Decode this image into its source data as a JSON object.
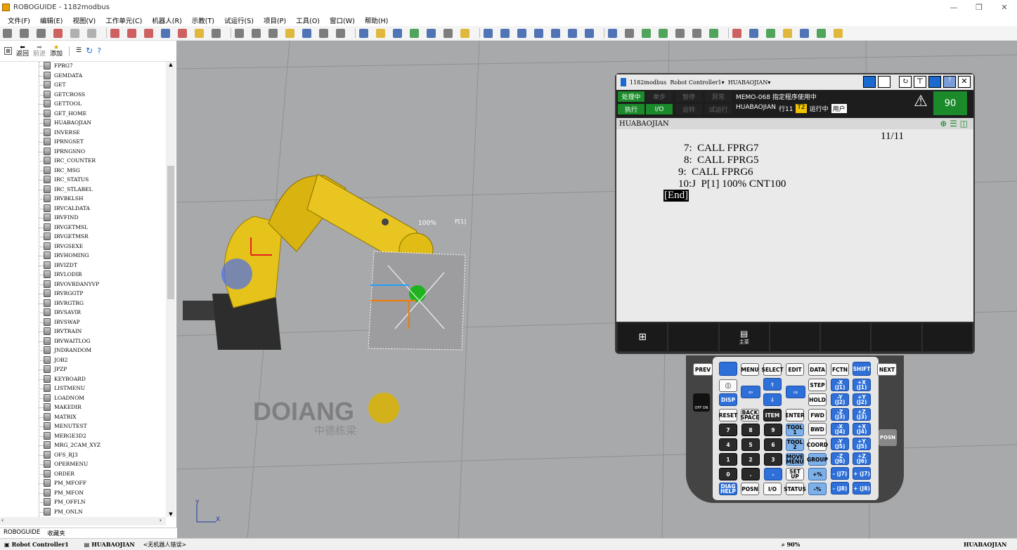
{
  "window": {
    "title": "ROBOGUIDE - 1182modbus",
    "min": "—",
    "max": "❐",
    "close": "✕"
  },
  "menu": [
    "文件(F)",
    "编辑(E)",
    "视图(V)",
    "工作单元(C)",
    "机器人(R)",
    "示教(T)",
    "试运行(S)",
    "项目(P)",
    "工具(O)",
    "窗口(W)",
    "帮助(H)"
  ],
  "left_toolbar": {
    "back": "返回",
    "forward": "前进",
    "add": "添加"
  },
  "tree_items": [
    "FPRG7",
    "GEMDATA",
    "GET",
    "GETCROSS",
    "GETTOOL",
    "GET_HOME",
    "HUABAOJIAN",
    "INVERSE",
    "IPRNGSET",
    "IPRNGSNO",
    "IRC_COUNTER",
    "IRC_MSG",
    "IRC_STATUS",
    "IRC_STLABEL",
    "IRVBKLSH",
    "IRVCALDATA",
    "IRVFIND",
    "IRVGETMSL",
    "IRVGETMSR",
    "IRVGSEXE",
    "IRVHOMING",
    "IRVIZDT",
    "IRVLODIR",
    "IRVOVRDANYVP",
    "IRVRGGTP",
    "IRVRGTRG",
    "IRVSAVIR",
    "IRVSWAP",
    "IRVTRAIN",
    "IRVWAITLOG",
    "JNDRANDOM",
    "JOB2",
    "JPZP",
    "KEYBOARD",
    "LISTMENU",
    "LOADNOM",
    "MAKEDIR",
    "MATRIX",
    "MENUTEST",
    "MERGE3D2",
    "MRG_2CAM_XYZ",
    "OFS_RJ3",
    "OPERMENU",
    "ORDER",
    "PM_MFOFF",
    "PM_MFON",
    "PM_OFFLN",
    "PM_ONLN"
  ],
  "left_tabs": [
    "ROBOGUIDE",
    "收藏夹"
  ],
  "statusbar": {
    "controller": "Robot Controller1",
    "program": "HUABAOJIAN",
    "error": "<无机器人错误>",
    "zoom": "90%",
    "right_program": "HUABAOJIAN"
  },
  "viewport": {
    "overlay_percent": "100%",
    "overlay_pos": "P[1]",
    "watermark": "DOIANG",
    "watermark_sub": "中德栋梁",
    "axis_x": "X",
    "axis_y": "Y"
  },
  "pendant": {
    "title": "1182modbus",
    "controller": "Robot Controller1",
    "program": "HUABAOJIAN",
    "status_row1": [
      "处理中",
      "单步",
      "暂停",
      "异常"
    ],
    "status_row2": [
      "执行",
      "I/O",
      "运转",
      "试运行"
    ],
    "message1": "MEMO-068 指定程序使用中",
    "message2_prog": "HUABAOJIAN",
    "message2_line": "行11",
    "message2_mode": "T2",
    "message2_state": "运行中",
    "message2_unit": "用户",
    "override": "90",
    "prog_header": "HUABAOJIAN",
    "line_count": "11/11",
    "lines": [
      "7:  CALL FPRG7",
      "8:  CALL FPRG5",
      "9:  CALL FPRG6",
      "10:J  P[1] 100% CNT100"
    ],
    "end_marker": "[End]",
    "fkey_label": "主菜",
    "colors": {
      "green": "#1a8a2a",
      "accent": "#f0c400"
    }
  },
  "keypad": {
    "top_row": [
      "PREV",
      "MENU",
      "SELECT",
      "EDIT",
      "DATA",
      "FCTN",
      "SHIFT",
      "NEXT"
    ],
    "keys": {
      "disp": "DISP",
      "reset": "RESET",
      "back_space": "BACK SPACE",
      "item": "ITEM",
      "enter": "ENTER",
      "step": "STEP",
      "hold": "HOLD",
      "fwd": "FWD",
      "bwd": "BWD",
      "coord": "COORD",
      "group": "GROUP",
      "tool1": "TOOL 1",
      "tool2": "TOOL 2",
      "move_menu": "MOVE MENU",
      "set_up": "SET UP",
      "status": "STATUS",
      "diag_help": "DIAG HELP",
      "posn": "POSN",
      "io": "I/O",
      "posn_side": "POSN",
      "n7": "7",
      "n8": "8",
      "n9": "9",
      "n4": "4",
      "n5": "5",
      "n6": "6",
      "n1": "1",
      "n2": "2",
      "n3": "3",
      "n0": "0",
      "dot": ".",
      "minus": "-",
      "jog": [
        "-X (J1)",
        "+X (J1)",
        "-Y (J2)",
        "+Y (J2)",
        "-Z (J3)",
        "+Z (J3)",
        "-X (J4)",
        "+X (J4)",
        "-Y (J5)",
        "+Y (J5)",
        "-Z (J6)",
        "+Z (J6)",
        "- (J7)",
        "+ (J7)",
        "- (J8)",
        "+ (J8)"
      ],
      "off_on": "OFF ON"
    }
  }
}
